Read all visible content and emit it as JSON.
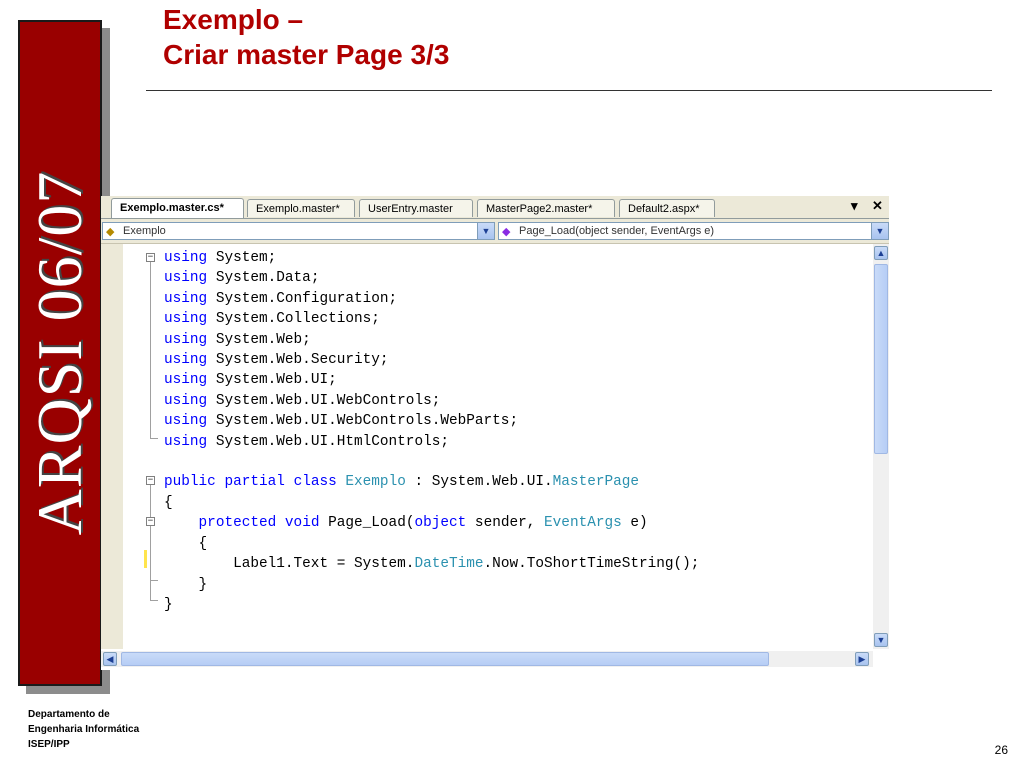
{
  "banner": {
    "text": "ARQSI 06/07",
    "color": "#990000"
  },
  "title": {
    "line1": "Exemplo –",
    "line2": "Criar master Page 3/3",
    "color": "#b00000"
  },
  "ide": {
    "tabs": [
      {
        "label": "Exemplo.master.cs*",
        "active": true
      },
      {
        "label": "Exemplo.master*",
        "active": false
      },
      {
        "label": "UserEntry.master",
        "active": false
      },
      {
        "label": "MasterPage2.master*",
        "active": false
      },
      {
        "label": "Default2.aspx*",
        "active": false
      }
    ],
    "tab_menu_icon": "dropdown-pin-icon",
    "close_icon": "close-icon",
    "class_combo": {
      "value": "Exemplo",
      "icon": "class-icon"
    },
    "member_combo": {
      "value": "Page_Load(object sender, EventArgs e)",
      "icon": "method-icon"
    },
    "code_lines": [
      [
        {
          "k": "kw",
          "t": "using"
        },
        {
          "t": " System;"
        }
      ],
      [
        {
          "k": "kw",
          "t": "using"
        },
        {
          "t": " System.Data;"
        }
      ],
      [
        {
          "k": "kw",
          "t": "using"
        },
        {
          "t": " System.Configuration;"
        }
      ],
      [
        {
          "k": "kw",
          "t": "using"
        },
        {
          "t": " System.Collections;"
        }
      ],
      [
        {
          "k": "kw",
          "t": "using"
        },
        {
          "t": " System.Web;"
        }
      ],
      [
        {
          "k": "kw",
          "t": "using"
        },
        {
          "t": " System.Web.Security;"
        }
      ],
      [
        {
          "k": "kw",
          "t": "using"
        },
        {
          "t": " System.Web.UI;"
        }
      ],
      [
        {
          "k": "kw",
          "t": "using"
        },
        {
          "t": " System.Web.UI.WebControls;"
        }
      ],
      [
        {
          "k": "kw",
          "t": "using"
        },
        {
          "t": " System.Web.UI.WebControls.WebParts;"
        }
      ],
      [
        {
          "k": "kw",
          "t": "using"
        },
        {
          "t": " System.Web.UI.HtmlControls;"
        }
      ],
      [],
      [
        {
          "k": "kw",
          "t": "public"
        },
        {
          "t": " "
        },
        {
          "k": "kw",
          "t": "partial"
        },
        {
          "t": " "
        },
        {
          "k": "kw",
          "t": "class"
        },
        {
          "t": " "
        },
        {
          "k": "ty",
          "t": "Exemplo"
        },
        {
          "t": " : System.Web.UI."
        },
        {
          "k": "ty",
          "t": "MasterPage"
        }
      ],
      [
        {
          "t": "{"
        }
      ],
      [
        {
          "t": "    "
        },
        {
          "k": "kw",
          "t": "protected"
        },
        {
          "t": " "
        },
        {
          "k": "kw",
          "t": "void"
        },
        {
          "t": " Page_Load("
        },
        {
          "k": "kw",
          "t": "object"
        },
        {
          "t": " sender, "
        },
        {
          "k": "ty",
          "t": "EventArgs"
        },
        {
          "t": " e)"
        }
      ],
      [
        {
          "t": "    {"
        }
      ],
      [
        {
          "t": "        Label1.Text = System."
        },
        {
          "k": "ty",
          "t": "DateTime"
        },
        {
          "t": ".Now.ToShortTimeString();"
        }
      ],
      [
        {
          "t": "    }"
        }
      ],
      [
        {
          "t": "}"
        }
      ]
    ],
    "colors": {
      "keyword": "#0000ff",
      "type": "#2b91af"
    }
  },
  "footer": {
    "line1": "Departamento de",
    "line2": "Engenharia Informática",
    "line3": "ISEP/IPP"
  },
  "page_number": "26"
}
